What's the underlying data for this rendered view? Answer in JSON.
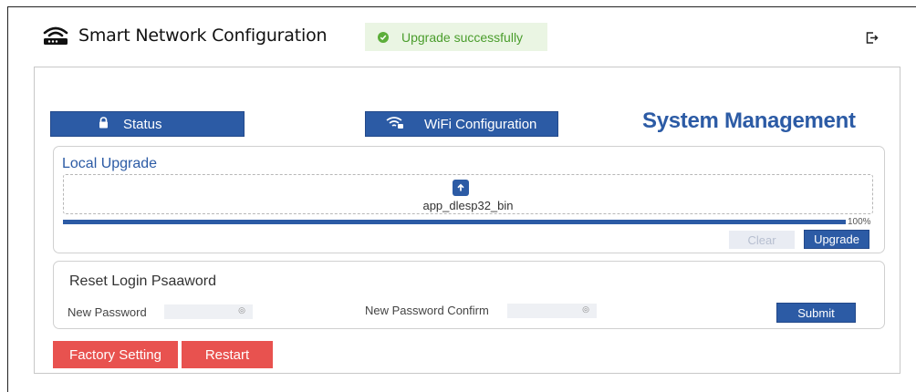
{
  "app": {
    "title": "Smart Network Configuration"
  },
  "toast": {
    "text": "Upgrade successfully",
    "color": "#4a9d2c"
  },
  "nav": {
    "status_label": "Status",
    "wifi_label": "WiFi Configuration"
  },
  "section": {
    "title": "System Management"
  },
  "local_upgrade": {
    "title": "Local Upgrade",
    "file_name": "app_dlesp32_bin",
    "progress": 1.0,
    "progress_label": "100%",
    "clear_label": "Clear",
    "upgrade_label": "Upgrade"
  },
  "reset": {
    "title": "Reset Login Psaaword",
    "new_password_label": "New Password",
    "new_password_value": "",
    "confirm_label": "New Password Confirm",
    "confirm_value": "",
    "submit_label": "Submit"
  },
  "actions": {
    "factory_label": "Factory Setting",
    "restart_label": "Restart"
  },
  "icons": {
    "brand": "router-icon",
    "toast": "check-circle-icon",
    "logout": "logout-icon",
    "status": "lock-icon",
    "wifi": "wifi-icon",
    "upload": "upload-icon",
    "eye": "eye-icon"
  },
  "colors": {
    "primary": "#2c5ba5",
    "danger": "#e8524f",
    "success": "#5cae3a"
  }
}
